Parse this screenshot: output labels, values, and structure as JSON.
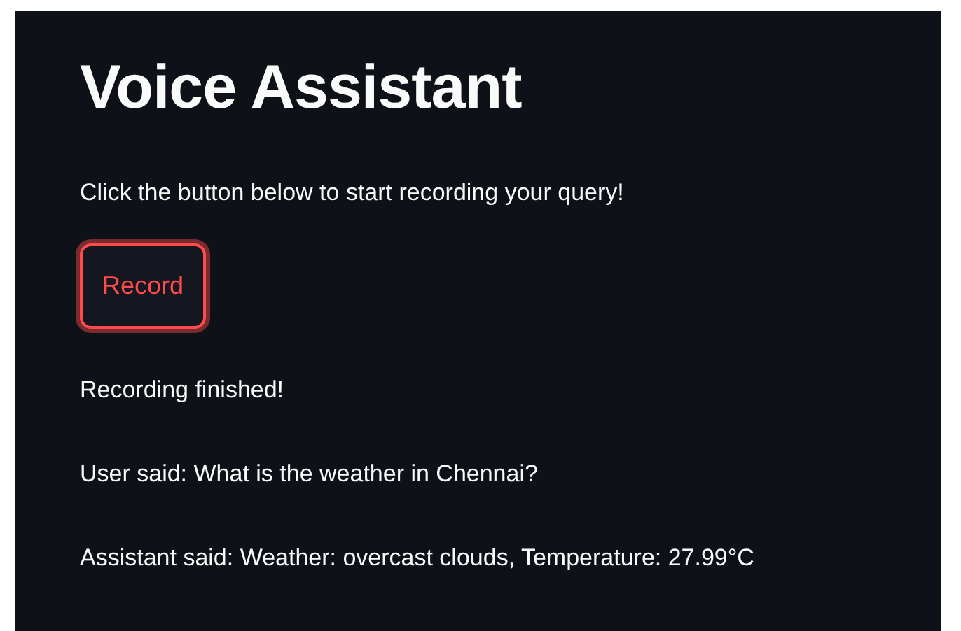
{
  "title": "Voice Assistant",
  "intro": "Click the button below to start recording your query!",
  "button": {
    "label": "Record"
  },
  "messages": [
    "Recording finished!",
    "User said: What is the weather in Chennai?",
    "Assistant said: Weather: overcast clouds, Temperature: 27.99°C"
  ]
}
